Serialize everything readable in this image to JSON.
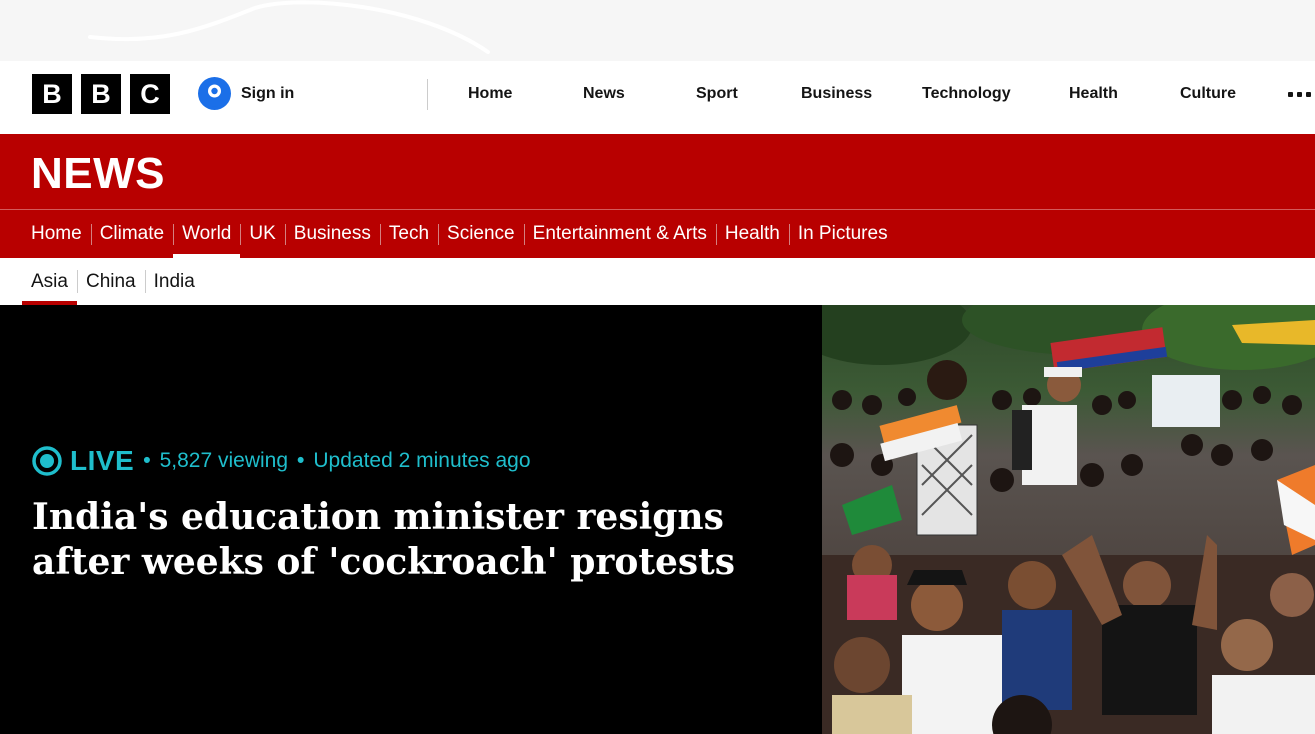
{
  "masthead": {
    "logo_letters": [
      "B",
      "B",
      "C"
    ],
    "signin_label": "Sign in",
    "nav": [
      "Home",
      "News",
      "Sport",
      "Business",
      "Technology",
      "Health",
      "Culture"
    ],
    "more_icon": "more-dots-icon"
  },
  "news_band": {
    "title": "NEWS",
    "sections": [
      "Home",
      "Climate",
      "World",
      "UK",
      "Business",
      "Tech",
      "Science",
      "Entertainment & Arts",
      "Health",
      "In Pictures"
    ],
    "active_section": "World"
  },
  "sub_nav": {
    "items": [
      "Asia",
      "China",
      "India"
    ],
    "active": "Asia"
  },
  "hero": {
    "live_label": "LIVE",
    "viewing": "5,827 viewing",
    "updated": "Updated 2 minutes ago",
    "separator": "•",
    "headline": "India's education minister resigns after weeks of 'cockroach' protests",
    "image_alt": "Crowd of protesters sitting on the ground holding placards and flags"
  },
  "colors": {
    "bbc_red": "#b80000",
    "live_teal": "#1fbecc",
    "hero_bg": "#000000",
    "signin_blue": "#1b6fe8"
  }
}
